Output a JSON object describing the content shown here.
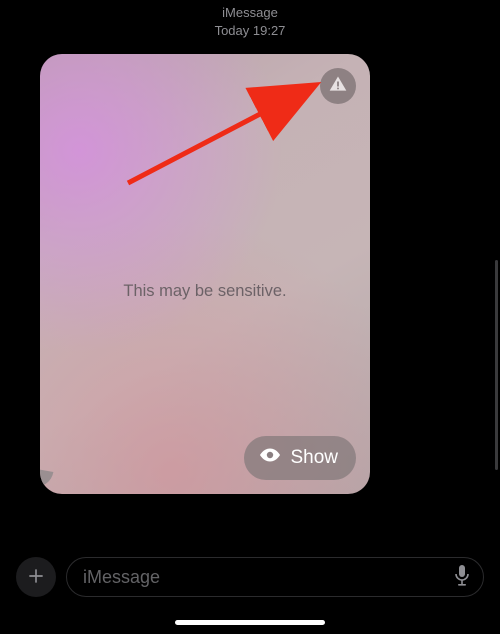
{
  "header": {
    "service": "iMessage",
    "timestamp": "Today 19:27"
  },
  "bubble": {
    "sensitive_label": "This may be sensitive.",
    "show_label": "Show"
  },
  "input": {
    "placeholder": "iMessage"
  },
  "icons": {
    "warning": "warning-icon",
    "eye": "eye-icon",
    "plus": "plus-icon",
    "mic": "mic-icon"
  },
  "colors": {
    "badge_bg": "rgba(120,110,112,0.72)",
    "show_bg": "rgba(130,120,122,0.72)",
    "arrow": "#ef2b17"
  }
}
